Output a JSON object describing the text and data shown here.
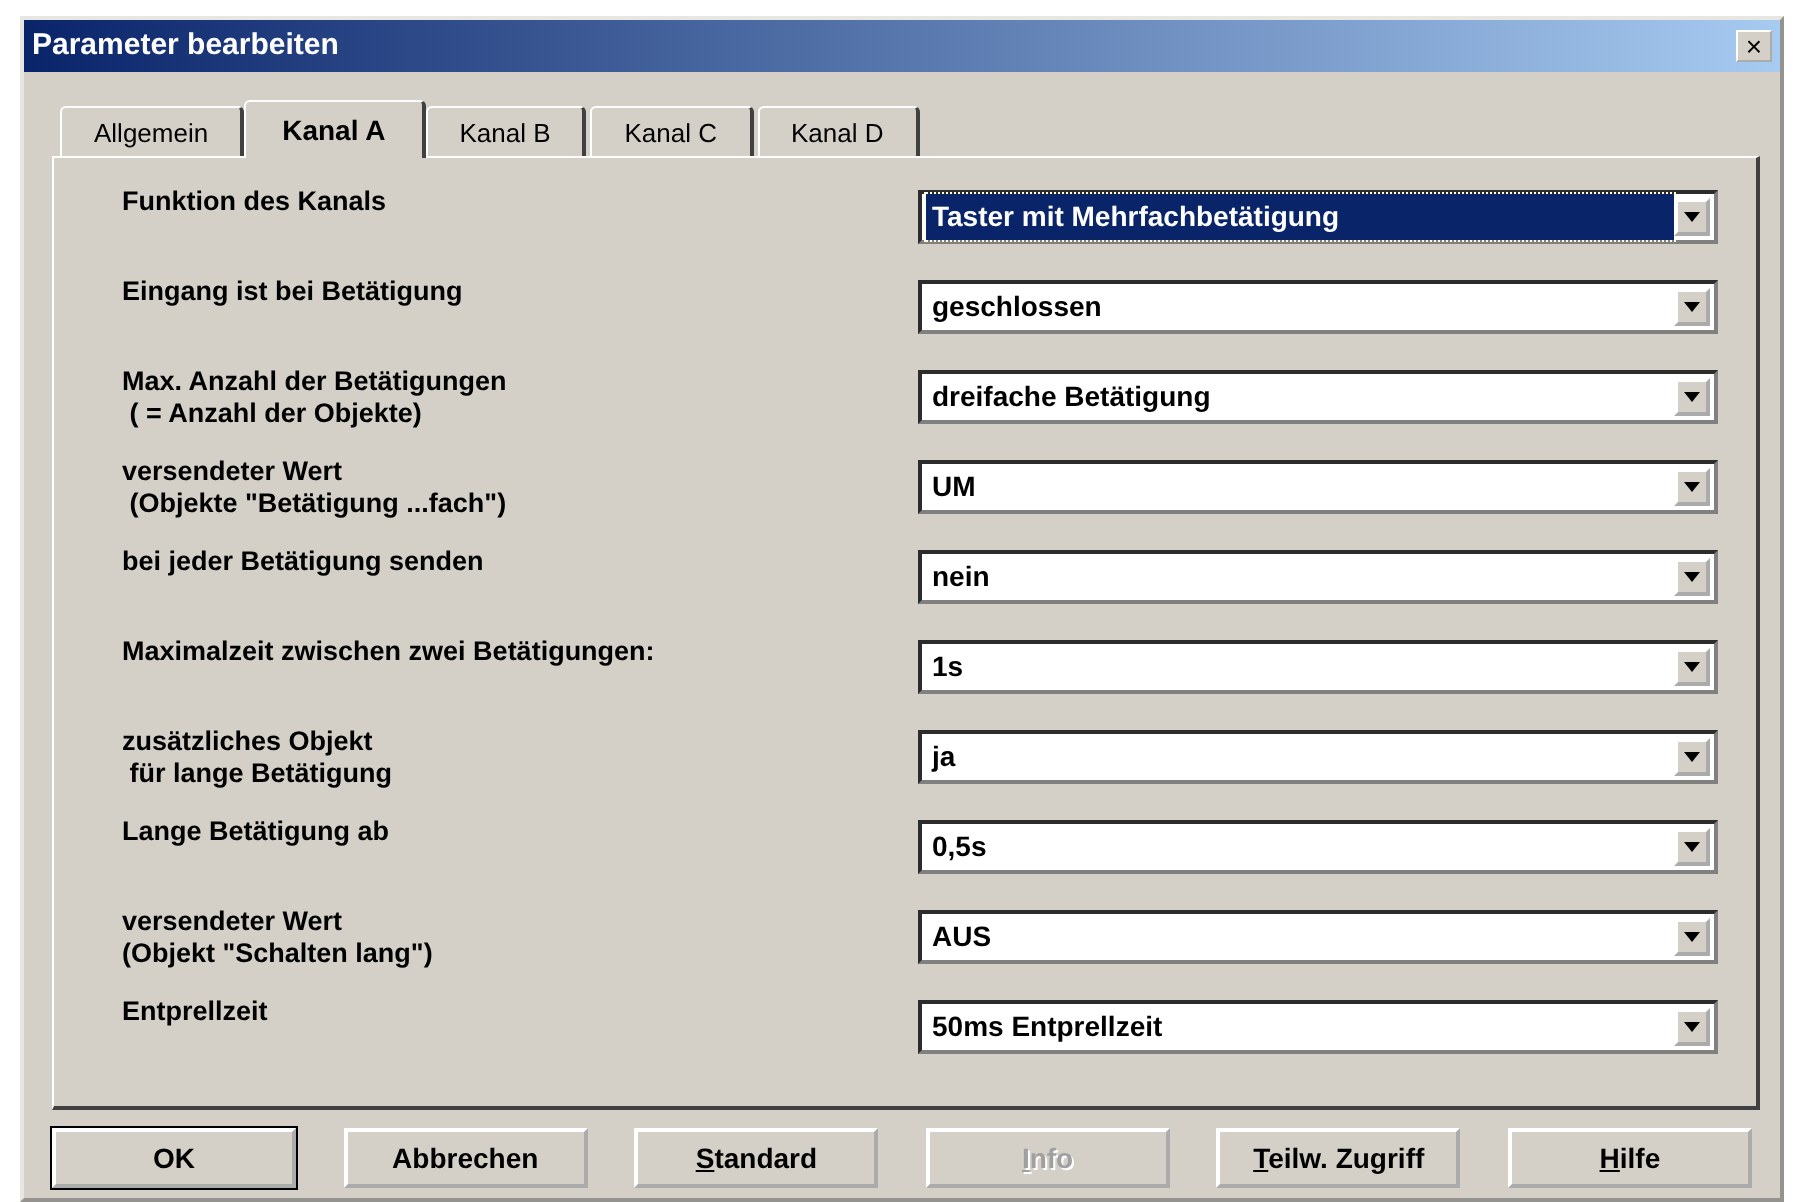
{
  "window": {
    "title": "Parameter bearbeiten",
    "close": "×"
  },
  "tabs": [
    {
      "label": "Allgemein",
      "selected": false
    },
    {
      "label": "Kanal A",
      "selected": true
    },
    {
      "label": "Kanal B",
      "selected": false
    },
    {
      "label": "Kanal C",
      "selected": false
    },
    {
      "label": "Kanal D",
      "selected": false
    }
  ],
  "parameters": [
    {
      "label": "Funktion des Kanals",
      "value": "Taster mit Mehrfachbetätigung",
      "focused": true
    },
    {
      "label": "Eingang ist bei Betätigung",
      "value": "geschlossen",
      "focused": false
    },
    {
      "label": "Max. Anzahl der Betätigungen\n ( = Anzahl der Objekte)",
      "value": "dreifache Betätigung",
      "focused": false
    },
    {
      "label": "versendeter Wert\n (Objekte \"Betätigung ...fach\")",
      "value": "UM",
      "focused": false
    },
    {
      "label": "bei jeder Betätigung senden",
      "value": "nein",
      "focused": false
    },
    {
      "label": "Maximalzeit zwischen zwei Betätigungen:",
      "value": "1s",
      "focused": false
    },
    {
      "label": "zusätzliches Objekt\n für lange Betätigung",
      "value": "ja",
      "focused": false
    },
    {
      "label": "Lange Betätigung ab",
      "value": "0,5s",
      "focused": false
    },
    {
      "label": "versendeter Wert\n(Objekt \"Schalten lang\")",
      "value": "AUS",
      "focused": false
    },
    {
      "label": "Entprellzeit",
      "value": "50ms Entprellzeit",
      "focused": false
    }
  ],
  "buttons": [
    {
      "label": "OK",
      "default": true,
      "disabled": false,
      "mnemonic": false
    },
    {
      "label": "Abbrechen",
      "default": false,
      "disabled": false,
      "mnemonic": false
    },
    {
      "label": "Standard",
      "default": false,
      "disabled": false,
      "mnemonic": true
    },
    {
      "label": "Info",
      "default": false,
      "disabled": true,
      "mnemonic": true
    },
    {
      "label": "Teilw. Zugriff",
      "default": false,
      "disabled": false,
      "mnemonic": true
    },
    {
      "label": "Hilfe",
      "default": false,
      "disabled": false,
      "mnemonic": true
    }
  ]
}
